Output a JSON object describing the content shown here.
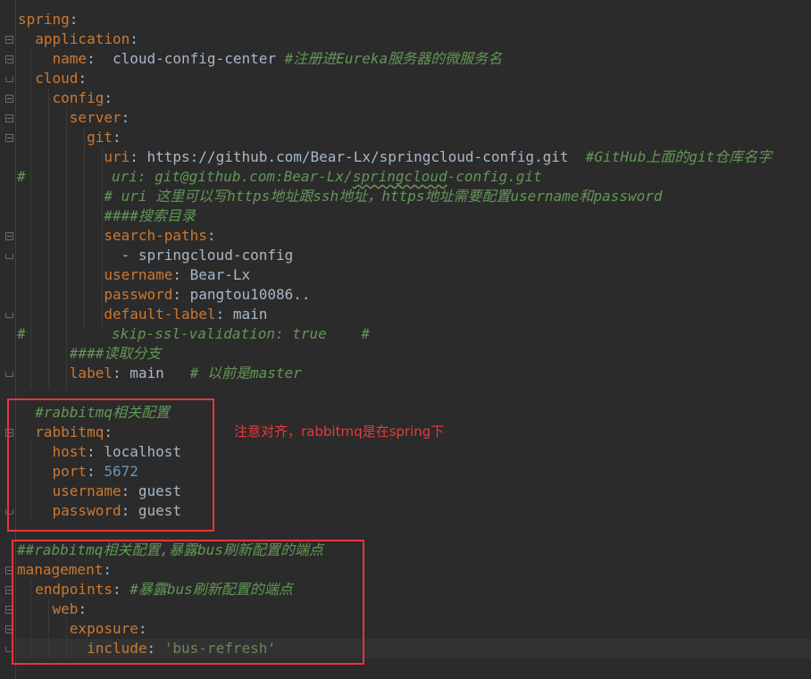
{
  "editor": {
    "language": "yaml",
    "theme_colors": {
      "background": "#2b2b2b",
      "key": "#cc7832",
      "value": "#a9b7c6",
      "number": "#6897bb",
      "string": "#6a8759",
      "comment": "#629755",
      "highlight_box": "#e8353a"
    },
    "lines": {
      "l1_key": "spring",
      "l2_key": "application",
      "l3_key": "name",
      "l3_value": "cloud-config-center",
      "l3_comment": "#注册进Eureka服务器的微服务名",
      "l4_key": "cloud",
      "l5_key": "config",
      "l6_key": "server",
      "l7_key": "git",
      "l8_key": "uri",
      "l8_value": "https://github.com/Bear-Lx/springcloud-config.git",
      "l8_comment": "#GitHub上面的git仓库名字",
      "l9_hash": "#",
      "l9_comment_a": "uri: git@github.com:Bear-Lx/",
      "l9_comment_b": "springcloud",
      "l9_comment_c": "-config.git",
      "l10_comment": "# uri 这里可以写https地址跟ssh地址，https地址需要配置username和password",
      "l11_comment": "####搜索目录",
      "l12_key": "search-paths",
      "l13_value": "- springcloud-config",
      "l14_key": "username",
      "l14_value": "Bear-Lx",
      "l15_key": "password",
      "l15_value": "pangtou10086..",
      "l16_key": "default-label",
      "l16_value": "main",
      "l17_hash": "#",
      "l17_comment": "skip-ssl-validation: true    #",
      "l18_comment": "####读取分支",
      "l19_key": "label",
      "l19_value": "main",
      "l19_comment": "# 以前是master",
      "l21_comment": "#rabbitmq相关配置",
      "l22_key": "rabbitmq",
      "l23_key": "host",
      "l23_value": "localhost",
      "l24_key": "port",
      "l24_value": "5672",
      "l25_key": "username",
      "l25_value": "guest",
      "l26_key": "password",
      "l26_value": "guest",
      "l28_comment": "##rabbitmq相关配置,暴露bus刷新配置的端点",
      "l29_key": "management",
      "l30_key": "endpoints",
      "l30_comment": "#暴露bus刷新配置的端点",
      "l31_key": "web",
      "l32_key": "exposure",
      "l33_key": "include",
      "l33_value": "'bus-refresh'"
    },
    "annotation": "注意对齐，rabbitmq是在spring下"
  }
}
